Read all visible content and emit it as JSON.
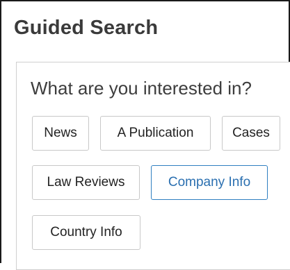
{
  "header": {
    "title": "Guided Search"
  },
  "panel": {
    "question": "What are you interested in?",
    "options": [
      {
        "label": "News",
        "selected": false
      },
      {
        "label": "A Publication",
        "selected": false
      },
      {
        "label": "Cases",
        "selected": false
      },
      {
        "label": "Law Reviews",
        "selected": false
      },
      {
        "label": "Company Info",
        "selected": true
      },
      {
        "label": "Country Info",
        "selected": false
      }
    ]
  },
  "colors": {
    "selected_border": "#2f7fc1",
    "selected_text": "#2a6fb0",
    "chip_border": "#c8c8c8",
    "title_text": "#3a3a3a"
  }
}
